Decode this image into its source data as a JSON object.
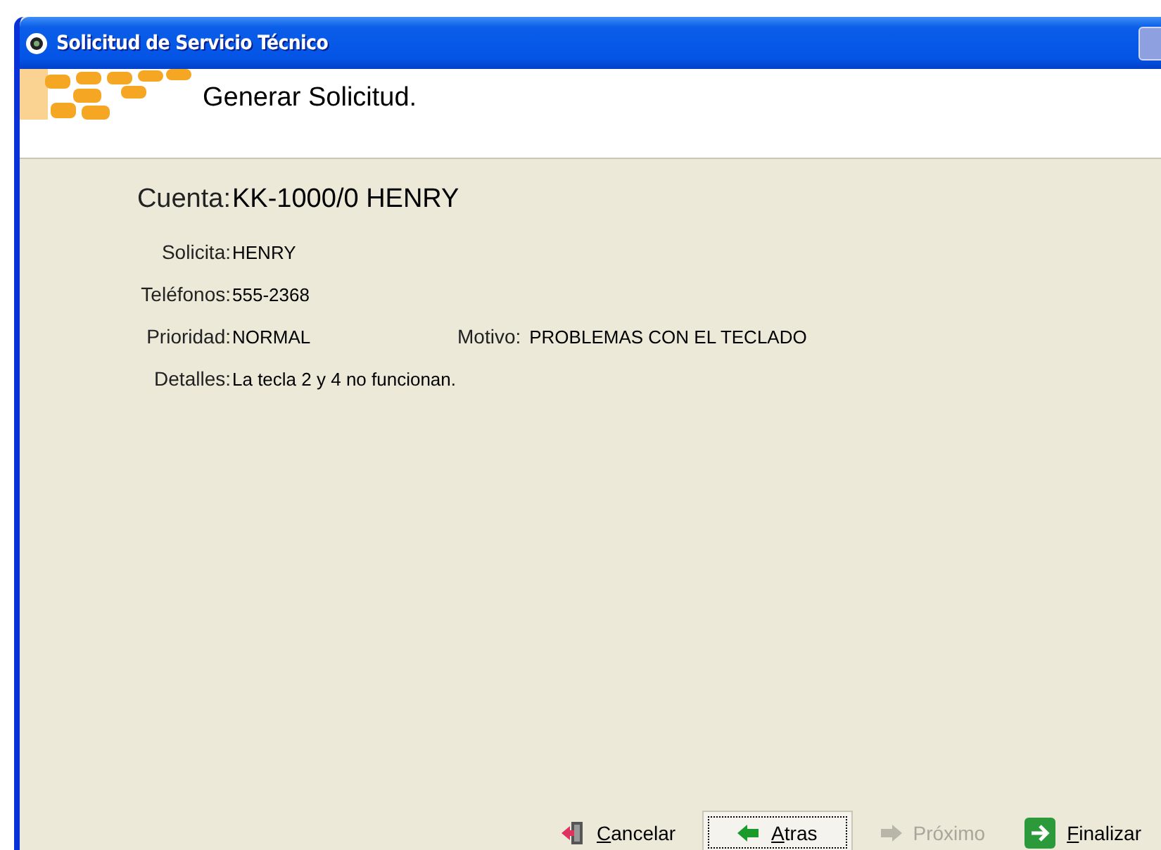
{
  "window": {
    "title": "Solicitud de Servicio Técnico"
  },
  "header": {
    "title": "Generar Solicitud."
  },
  "account": {
    "label": "Cuenta:",
    "value": "KK-1000/0 HENRY"
  },
  "fields": [
    {
      "label": "Solicita:",
      "value": "HENRY"
    },
    {
      "label": "Teléfonos:",
      "value": "555-2368"
    },
    {
      "label": "Prioridad:",
      "value": "NORMAL",
      "extra_label": "Motivo:",
      "extra_value": "PROBLEMAS CON EL TECLADO"
    },
    {
      "label": "Detalles:",
      "value": "La tecla 2 y 4 no funcionan."
    }
  ],
  "buttons": [
    {
      "label": "Cancelar",
      "kind": "cancel",
      "focused": false,
      "disabled": false,
      "underline_first": true
    },
    {
      "label": "Atras",
      "kind": "back",
      "focused": true,
      "disabled": false,
      "underline_first": true
    },
    {
      "label": "Próximo",
      "kind": "next",
      "focused": false,
      "disabled": true,
      "underline_first": false
    },
    {
      "label": "Finalizar",
      "kind": "finish",
      "focused": false,
      "disabled": false,
      "underline_first": true
    }
  ]
}
